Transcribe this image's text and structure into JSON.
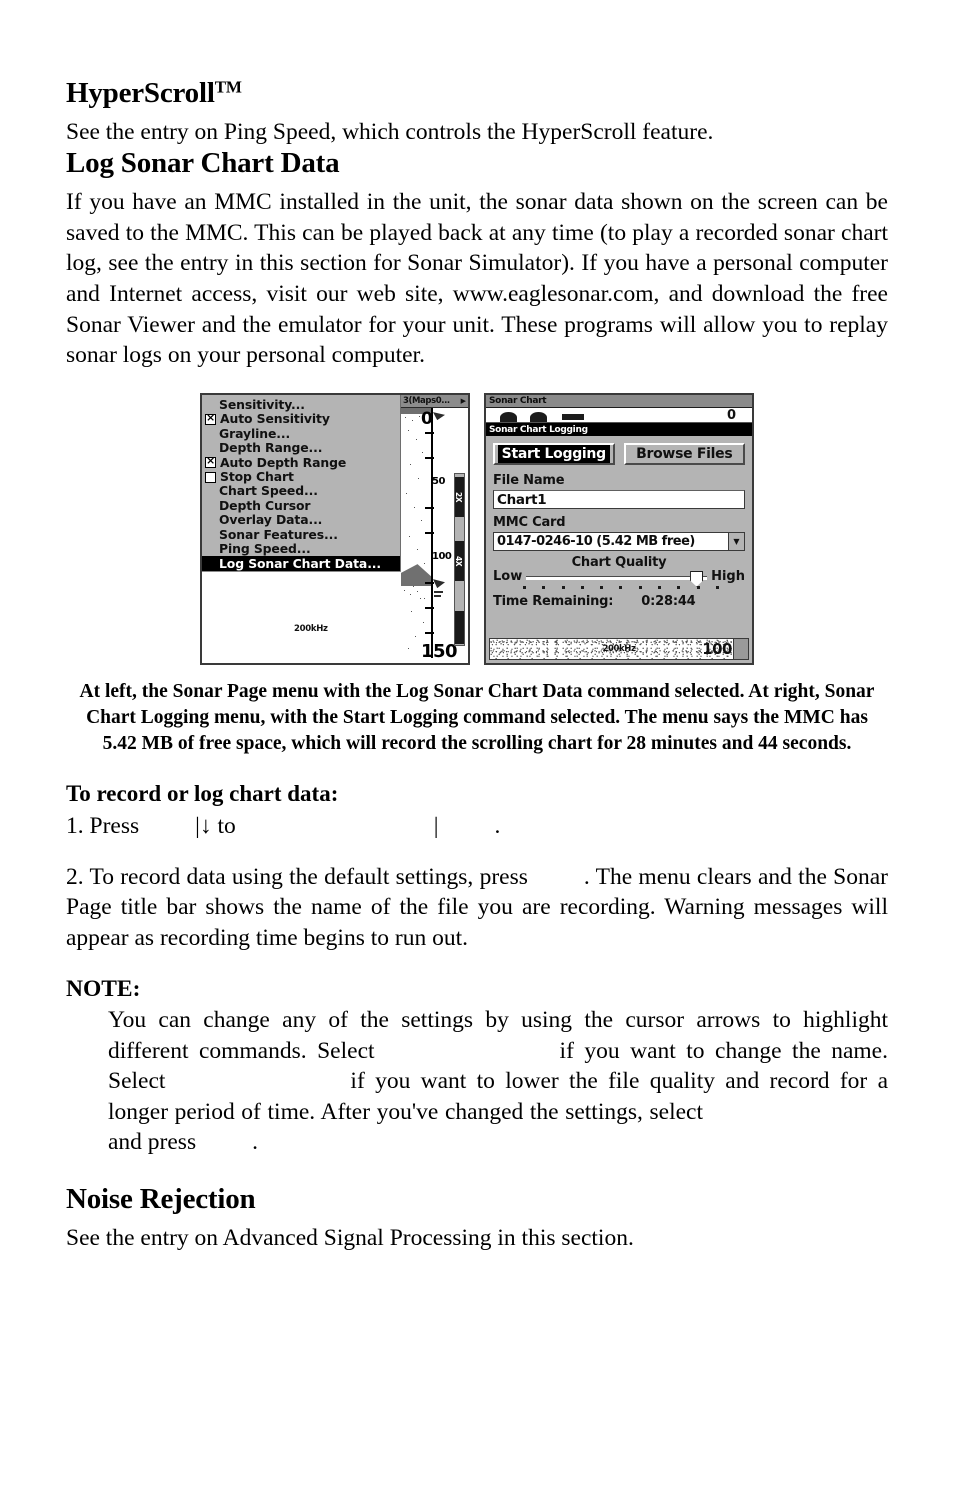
{
  "document": {
    "sections": [
      {
        "heading": "HyperScroll",
        "heading_superscript": "TM",
        "body": "See the entry on Ping Speed, which controls the HyperScroll feature."
      },
      {
        "heading": "Log Sonar Chart Data",
        "body": "If you have an MMC installed in the unit, the sonar data shown on the screen can be saved to the MMC. This can be played back at any time (to play a recorded sonar chart log, see the entry in this section for Sonar Simulator). If you have a personal computer and Internet access, visit our web site, www.eaglesonar.com, and download the free Sonar Viewer and the emulator for your unit. These programs will allow you to replay sonar logs on your personal computer."
      },
      {
        "heading": "Noise Rejection",
        "body": "See the entry on Advanced Signal Processing in this section."
      }
    ],
    "caption": "At left, the Sonar Page menu with the Log Sonar Chart Data command selected. At right, Sonar Chart Logging menu, with the Start Logging command selected. The menu says the MMC has 5.42 MB of free space, which will record the scrolling chart for 28 minutes and 44 seconds.",
    "procedure": {
      "title": "To record or log chart data:",
      "step1_part1": "1. Press",
      "step1_pipe1": "|",
      "step1_arrow": "↓",
      "step1_part2": "to",
      "step1_pipe2": "|",
      "step1_period": ".",
      "step2_part1": "2. To record data using the default settings, press",
      "step2_part2": ". The menu clears and the Sonar Page title bar shows the name of the file you are recording. Warning messages will appear as recording time begins to run out."
    },
    "note": {
      "label": "NOTE:",
      "line_a": "You can change any of the settings by using the cursor arrows to highlight different commands. Select",
      "line_b": "if you want to change the name. Select",
      "line_c": "if you want to lower the file quality and record for a longer period of time. After you've changed the settings, select",
      "line_d": "and press",
      "line_e": "."
    }
  },
  "figure": {
    "left_screenshot": {
      "name": "sonar-page-menu",
      "title_bar": "3(Maps0...",
      "title_bar_arrow": "▶",
      "menu_items": [
        {
          "label": "Sensitivity...",
          "checkbox": "none",
          "selected": false
        },
        {
          "label": "Auto Sensitivity",
          "checkbox": "checked",
          "selected": false
        },
        {
          "label": "Grayline...",
          "checkbox": "none",
          "selected": false
        },
        {
          "label": "Depth Range...",
          "checkbox": "none",
          "selected": false
        },
        {
          "label": "Auto Depth Range",
          "checkbox": "checked",
          "selected": false
        },
        {
          "label": "Stop Chart",
          "checkbox": "unchecked",
          "selected": false
        },
        {
          "label": "Chart Speed...",
          "checkbox": "none",
          "selected": false
        },
        {
          "label": "Depth Cursor",
          "checkbox": "none",
          "selected": false
        },
        {
          "label": "Overlay Data...",
          "checkbox": "none",
          "selected": false
        },
        {
          "label": "Sonar Features...",
          "checkbox": "none",
          "selected": false
        },
        {
          "label": "Ping Speed...",
          "checkbox": "none",
          "selected": false
        },
        {
          "label": "Log Sonar Chart Data...",
          "checkbox": "none",
          "selected": true
        }
      ],
      "frequency_label": "200kHz",
      "depth_labels": [
        "0",
        "50",
        "100"
      ],
      "max_depth": "150",
      "zoom_bars": [
        "2X",
        "4X"
      ]
    },
    "right_screenshot": {
      "name": "sonar-chart-logging-menu",
      "title_bar": "Sonar Chart",
      "peek_depth": "0",
      "sub_title_bar": "Sonar Chart Logging",
      "buttons": [
        {
          "label": "Start Logging",
          "selected": true
        },
        {
          "label": "Browse Files",
          "selected": false
        }
      ],
      "file_name_label": "File Name",
      "file_name_value": "Chart1",
      "mmc_card_label": "MMC Card",
      "mmc_card_value": "0147-0246-10 (5.42 MB free)",
      "dropdown_arrow": "▼",
      "quality_label": "Chart Quality",
      "quality_low": "Low",
      "quality_high": "High",
      "quality_position_percent": 96,
      "quality_tick_count": 11,
      "time_remaining_label": "Time Remaining:",
      "time_remaining_value": "0:28:44",
      "footer_frequency": "200kHz",
      "footer_depth": "100"
    }
  },
  "colors": {
    "screen_gray": "#b4b4b4",
    "title_gray": "#8a8a8a",
    "selected_black": "#000000",
    "selected_text": "#ffffff",
    "field_white": "#ffffff",
    "border_dark": "#3a3a3a",
    "page_background": "#ffffff",
    "text": "#000000"
  }
}
